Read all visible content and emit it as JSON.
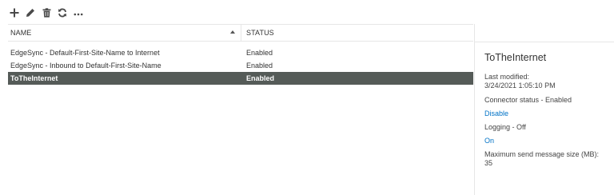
{
  "toolbar": {
    "add_icon": "plus-icon",
    "edit_icon": "pencil-icon",
    "delete_icon": "trash-icon",
    "refresh_icon": "refresh-icon",
    "more_icon": "ellipsis-icon"
  },
  "grid": {
    "columns": {
      "name": "NAME",
      "status": "STATUS"
    },
    "sort": {
      "column": "name",
      "direction": "ascending"
    },
    "rows": [
      {
        "name": "EdgeSync - Default-First-Site-Name to Internet",
        "status": "Enabled"
      },
      {
        "name": "EdgeSync - Inbound to Default-First-Site-Name",
        "status": "Enabled"
      },
      {
        "name": "ToTheInternet",
        "status": "Enabled"
      }
    ],
    "selected_index": 2
  },
  "details": {
    "title": "ToTheInternet",
    "last_modified_label": "Last modified:",
    "last_modified_value": "3/24/2021 1:05:10 PM",
    "connector_status": "Connector status - Enabled",
    "disable_link": "Disable",
    "logging": "Logging - Off",
    "on_link": "On",
    "max_size_label": "Maximum send message size (MB):",
    "max_size_value": "35"
  },
  "colors": {
    "selected_row_bg": "#555b58",
    "link": "#0072c6",
    "toolbar_icon": "#4a4a4a"
  }
}
